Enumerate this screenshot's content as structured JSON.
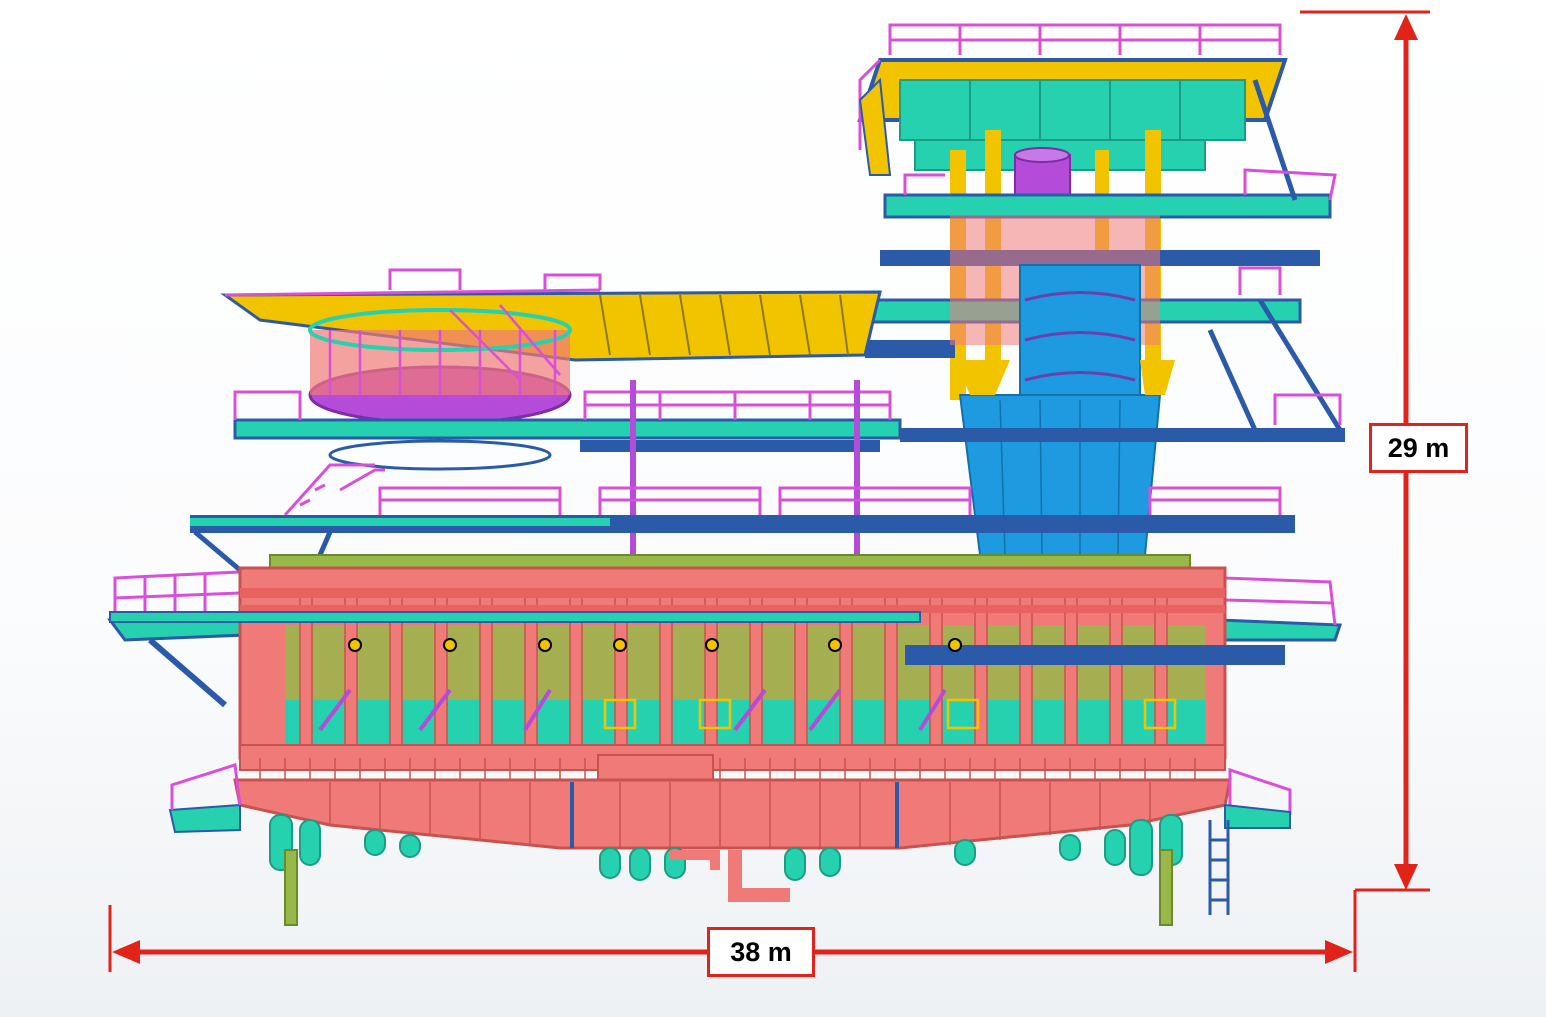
{
  "dimensions": {
    "height_label": "29 m",
    "width_label": "38 m"
  },
  "colors": {
    "dimension_line": "#e2231a",
    "main_box": "#f07a78",
    "secondary_steel": "#26d1b0",
    "beams": "#2b5aa8",
    "handrails": "#d94fd8",
    "accent": "#f2c400",
    "vessel": "#1e9be0",
    "frame": "#98b84a"
  }
}
